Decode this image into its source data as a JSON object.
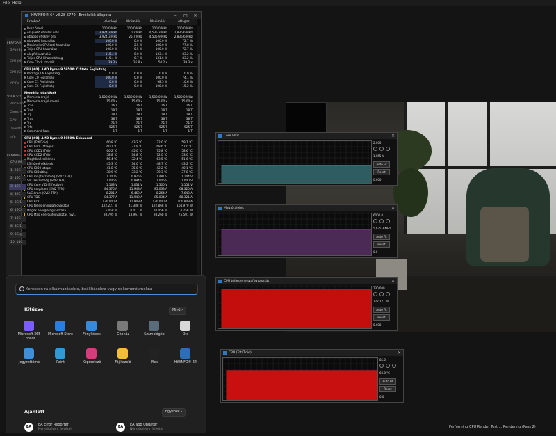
{
  "menubar": {
    "file": "File",
    "help": "Help"
  },
  "benchmark": {
    "sections": {
      "performance": "PERFORM",
      "your_system": "YOUR SYS",
      "ranking": "RANKING"
    },
    "performance_items": [
      "GPU (Sy",
      "CPU (M",
      "CPU (Sii",
      "MP Ra"
    ],
    "system_items": [
      "Processo",
      "Cores +",
      "GPU",
      "Operati",
      "Info"
    ],
    "ranking_items": [
      "CPU (M",
      "1. 28C",
      "2. 16C",
      "3. 16C",
      "4. 32C",
      "5. 8C/1",
      "6. 16C/",
      "7. 10C",
      "8. 8C/1",
      "9. 8C @",
      "10. 14C"
    ],
    "status": "Performing CPU Render Test ... Rendering (Pass 2)"
  },
  "hwinfo": {
    "title": "HWiNFO® 64 v8.28-5770 - Érzékelők állapota",
    "columns": {
      "sensor": "Érzékelő",
      "current": "Jelenlegi",
      "min": "Minimális",
      "max": "Maximális",
      "avg": "Átlagos"
    },
    "rows": [
      {
        "type": "row",
        "icon": "clock",
        "name": "Busz órajel",
        "v": [
          "100.0 MHz",
          "100.0 MHz",
          "100.0 MHz",
          "100.0 MHz"
        ]
      },
      {
        "type": "row",
        "icon": "clock",
        "name": "Alapvető effektív órák",
        "v": [
          "3,924.3 MHz",
          "0.2 MHz",
          "4,535.3 MHz",
          "2,836.6 MHz"
        ],
        "hl": true
      },
      {
        "type": "row",
        "icon": "clock",
        "name": "Átlagos effektív óra",
        "v": [
          "3,924.3 MHz",
          "25.7 MHz",
          "4,505.9 MHz",
          "2,836.6 MHz"
        ]
      },
      {
        "type": "row",
        "icon": "clock",
        "name": "Alapvető használat",
        "v": [
          "100.0 %",
          "0.0 %",
          "100.0 %",
          "72.7 %"
        ],
        "hl": true
      },
      {
        "type": "row",
        "icon": "clock",
        "name": "Maximális CPU/szál használat",
        "v": [
          "100.0 %",
          "2.5 %",
          "100.0 %",
          "77.8 %"
        ]
      },
      {
        "type": "row",
        "icon": "clock",
        "name": "Teljes CPU használat",
        "v": [
          "100.0 %",
          "0.5 %",
          "100.0 %",
          "72.7 %"
        ]
      },
      {
        "type": "row",
        "icon": "clock",
        "name": "Alapfelhasználás",
        "v": [
          "115.4 %",
          "0.0 %",
          "133.4 %",
          "83.2 %"
        ],
        "hl": true
      },
      {
        "type": "row",
        "icon": "clock",
        "name": "Teljes CPU kihasználtság",
        "v": [
          "115.4 %",
          "0.7 %",
          "131.6 %",
          "83.2 %"
        ]
      },
      {
        "type": "row",
        "icon": "clock",
        "name": "Core Clock szorzók",
        "v": [
          "39.3 x",
          "26.8 x",
          "50.2 x",
          "39.3 x"
        ],
        "hl": true
      },
      {
        "type": "hdr",
        "name": "CPU [#0]: AMD Ryzen 9 5950X: C-State Foglaltság"
      },
      {
        "type": "row",
        "icon": "clock",
        "name": "Package C6 Foglaltság",
        "v": [
          "0.0 %",
          "0.0 %",
          "0.0 %",
          "0.0 %"
        ]
      },
      {
        "type": "row",
        "icon": "clock",
        "name": "Core C0 Foglaltság",
        "v": [
          "100.0 %",
          "0.0 %",
          "100.0 %",
          "74.1 %"
        ],
        "hl": true
      },
      {
        "type": "row",
        "icon": "clock",
        "name": "Core C1 Foglaltság",
        "v": [
          "0.0 %",
          "0.0 %",
          "98.5 %",
          "10.6 %"
        ],
        "hl": true
      },
      {
        "type": "row",
        "icon": "clock",
        "name": "Core C6 Foglaltság",
        "v": [
          "0.0 %",
          "0.0 %",
          "100.0 %",
          "15.2 %"
        ],
        "hl": true
      },
      {
        "type": "hdr",
        "name": "Memória időzítések"
      },
      {
        "type": "row",
        "icon": "clock",
        "name": "Memória órajel",
        "v": [
          "1,500.0 MHz",
          "1,500.0 MHz",
          "1,500.0 MHz",
          "1,500.0 MHz"
        ]
      },
      {
        "type": "row",
        "icon": "clock",
        "name": "Memória órajel szorzó",
        "v": [
          "15.00 x",
          "15.00 x",
          "15.00 x",
          "15.00 x"
        ]
      },
      {
        "type": "row",
        "icon": "clock",
        "name": "Tcas",
        "v": [
          "16 T",
          "16 T",
          "16 T",
          "16 T"
        ]
      },
      {
        "type": "row",
        "icon": "clock",
        "name": "Trcd",
        "v": [
          "18 T",
          "18 T",
          "18 T",
          "18 T"
        ]
      },
      {
        "type": "row",
        "icon": "clock",
        "name": "Trp",
        "v": [
          "18 T",
          "18 T",
          "18 T",
          "18 T"
        ]
      },
      {
        "type": "row",
        "icon": "clock",
        "name": "Tras",
        "v": [
          "38 T",
          "38 T",
          "38 T",
          "38 T"
        ]
      },
      {
        "type": "row",
        "icon": "clock",
        "name": "Trc",
        "v": [
          "71 T",
          "71 T",
          "71 T",
          "71 T"
        ]
      },
      {
        "type": "row",
        "icon": "clock",
        "name": "Trfc",
        "v": [
          "525 T",
          "525 T",
          "525 T",
          "525 T"
        ]
      },
      {
        "type": "row",
        "icon": "clock",
        "name": "Command Rate",
        "v": [
          "1 T",
          "1 T",
          "1 T",
          "1 T"
        ]
      },
      {
        "type": "hdr",
        "name": "CPU [#0]: AMD Ryzen 9 5950X: Enhanced"
      },
      {
        "type": "row",
        "icon": "temp",
        "name": "CPU (Tctl/Tdie)",
        "v": [
          "60.8 °C",
          "43.2 °C",
          "72.0 °C",
          "59.7 °C"
        ]
      },
      {
        "type": "row",
        "icon": "temp",
        "name": "CPU hűtő (átlagos)",
        "v": [
          "60.1 °C",
          "37.9 °C",
          "68.6 °C",
          "57.0 °C"
        ]
      },
      {
        "type": "row",
        "icon": "temp",
        "name": "CPU CCD1 (Tdie)",
        "v": [
          "60.2 °C",
          "45.0 °C",
          "75.8 °C",
          "58.6 °C"
        ]
      },
      {
        "type": "row",
        "icon": "temp",
        "name": "CPU CCD2 (Tdie)",
        "v": [
          "58.8 °C",
          "34.8 °C",
          "72.0 °C",
          "53.0 °C"
        ]
      },
      {
        "type": "row",
        "icon": "temp",
        "name": "Maghőmérsékletek",
        "v": [
          "56.4 °C",
          "32.4 °C",
          "63.5 °C",
          "51.6 °C"
        ]
      },
      {
        "type": "row",
        "icon": "temp",
        "name": "L3 hőmérsékletek",
        "v": [
          "45.3 °C",
          "34.0 °C",
          "48.7 °C",
          "43.2 °C"
        ]
      },
      {
        "type": "row",
        "icon": "temp",
        "name": "CPU IOD Hotspot",
        "v": [
          "41.8 °C",
          "35.0 °C",
          "42.2 °C",
          "40.1 °C"
        ]
      },
      {
        "type": "row",
        "icon": "temp",
        "name": "CPU IOD átlag",
        "v": [
          "38.9 °C",
          "33.2 °C",
          "39.3 °C",
          "37.8 °C"
        ]
      },
      {
        "type": "row",
        "icon": "volt",
        "name": "CPU magfeszültség (SVI2 TFN)",
        "v": [
          "1.100 V",
          "0.975 V",
          "1.481 V",
          "1.144 V"
        ]
      },
      {
        "type": "row",
        "icon": "volt",
        "name": "SoC Feszültség (SVI2 TFN)",
        "v": [
          "1.006 V",
          "0.994 V",
          "1.006 V",
          "1.000 V"
        ]
      },
      {
        "type": "row",
        "icon": "volt",
        "name": "CPU Core VID (Effective)",
        "v": [
          "1.163 V",
          "1.031 V",
          "1.500 V",
          "1.151 V"
        ]
      },
      {
        "type": "row",
        "icon": "volt",
        "name": "CPU magáram (SVI2 TFN)",
        "v": [
          "84.375 A",
          "11.943 A",
          "85.033 A",
          "68.320 A"
        ]
      },
      {
        "type": "row",
        "icon": "volt",
        "name": "SoC áram (SVI2 TFN)",
        "v": [
          "8.201 A",
          "6.469 A",
          "8.264 A",
          "7.643 A"
        ]
      },
      {
        "type": "row",
        "icon": "volt",
        "name": "CPU TDC",
        "v": [
          "84.377 A",
          "11.949 A",
          "85.034 A",
          "68.321 A"
        ]
      },
      {
        "type": "row",
        "icon": "volt",
        "name": "CPU EDC",
        "v": [
          "130.000 A",
          "11.949 A",
          "130.000 A",
          "100.809 A"
        ]
      },
      {
        "type": "row",
        "icon": "volt",
        "name": "CPU teljes energiafogyasztás",
        "v": [
          "122.227 W",
          "41.388 W",
          "122.868 W",
          "104.970 W"
        ]
      },
      {
        "type": "row",
        "icon": "volt",
        "name": "Magok energiafogyasztása",
        "v": [
          "5.458 W",
          "0.017 W",
          "10.056 W",
          "4.258 W"
        ]
      },
      {
        "type": "row",
        "icon": "volt",
        "name": "CPU Mag energiafogyasztás (SV...",
        "v": [
          "93.705 W",
          "13.967 W",
          "93.268 W",
          "75.501 W"
        ]
      }
    ]
  },
  "graphs": [
    {
      "title": "Core VIDs",
      "top": "2.000",
      "current": "1.055 V",
      "bottom": "0.000",
      "autofit": "Auto Fit",
      "reset": "Reset",
      "color": "#5c9aa0",
      "fill": "#2f5c60",
      "level": 0.42
    },
    {
      "title": "Mag órajelek",
      "top": "6000.0",
      "current": "5,935.3 MHz",
      "bottom": "0.0",
      "autofit": "Auto Fit",
      "reset": "Reset",
      "color": "#a055b0",
      "fill": "#4c2a56",
      "level": 0.62
    },
    {
      "title": "CPU teljes energiafogyasztás",
      "top": "130.000",
      "current": "122.227 W",
      "bottom": "0.000",
      "autofit": "Auto Fit",
      "reset": "Reset",
      "color": "#ff2020",
      "fill": "#c40e0e",
      "level": 0.94
    },
    {
      "title": "CPU (Tctl/Tdie)",
      "top": "85.0",
      "current": "60.8 °C",
      "bottom": "0.0",
      "autofit": "Auto Fit",
      "reset": "Reset",
      "color": "#ff2a2a",
      "fill": "#c81010",
      "level": 0.7
    }
  ],
  "start_menu": {
    "search_placeholder": "Keressen rá alkalmazásokra, beállításokra vagy dokumentumokra",
    "pinned_title": "Kitűzve",
    "all_button": "Mind",
    "apps": [
      {
        "label": "Microsoft 365 Copilot",
        "color": "#7b5cff"
      },
      {
        "label": "Microsoft Store",
        "color": "#2b7de0"
      },
      {
        "label": "Fényképek",
        "color": "#3a89d6"
      },
      {
        "label": "Gépház",
        "color": "#7a7a7a"
      },
      {
        "label": "Számológép",
        "color": "#5a6b7c"
      },
      {
        "label": "Óra",
        "color": "#d8d8d8"
      },
      {
        "label": "Jegyzettömb",
        "color": "#3c8fd8"
      },
      {
        "label": "Paint",
        "color": "#2f9ad8"
      },
      {
        "label": "Képmetsző",
        "color": "#d83b7c"
      },
      {
        "label": "Fájlkezelő",
        "color": "#f2c036"
      },
      {
        "label": "Plex",
        "color": "#222222"
      },
      {
        "label": "HWiNFO® 64",
        "color": "#2c6fb8"
      }
    ],
    "recommended_title": "Ajánlott",
    "more_button": "Egyebek",
    "recommended": [
      {
        "name": "EA Error Reporter",
        "sub": "Nemrég/nem felvétel"
      },
      {
        "name": "EA app Updater",
        "sub": "Nemrég/nem felvétel"
      }
    ]
  }
}
